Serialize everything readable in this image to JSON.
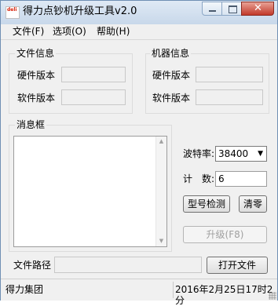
{
  "window": {
    "title": "得力点钞机升级工具v2.0",
    "icon_text": "deli"
  },
  "menu": [
    {
      "label": "文件(F)"
    },
    {
      "label": "选项(O)"
    },
    {
      "label": "帮助(H)"
    }
  ],
  "file_info": {
    "title": "文件信息",
    "hardware_label": "硬件版本",
    "hardware_value": "",
    "software_label": "软件版本",
    "software_value": ""
  },
  "machine_info": {
    "title": "机器信息",
    "hardware_label": "硬件版本",
    "hardware_value": "",
    "software_label": "软件版本",
    "software_value": ""
  },
  "messages": {
    "title": "消息框",
    "content": ""
  },
  "settings": {
    "baud_label": "波特率:",
    "baud_value": "38400",
    "count_label": "计　数:",
    "count_value": "6"
  },
  "buttons": {
    "detect": "型号检测",
    "clear": "清零",
    "upgrade": "升级(F8)",
    "open_file": "打开文件"
  },
  "file_path": {
    "label": "文件路径",
    "value": ""
  },
  "status": {
    "company": "得力集团",
    "datetime": "2016年2月25日17时2分"
  },
  "colors": {
    "accent_close": "#c2392a",
    "window_bg": "#f0f0f0",
    "titlebar": "#c8d8ea"
  }
}
